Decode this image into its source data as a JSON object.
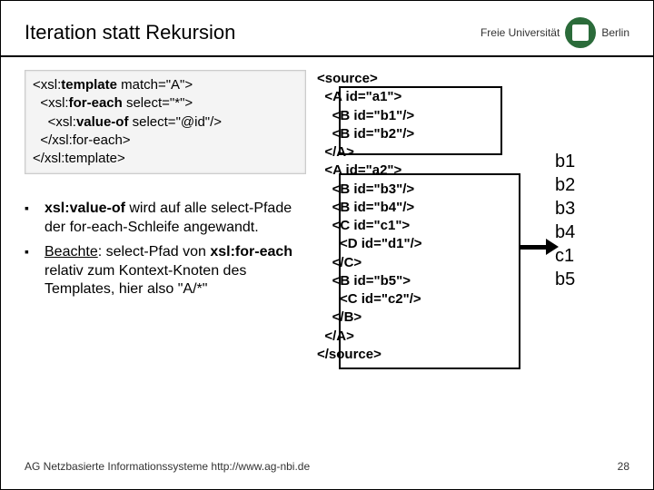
{
  "header": {
    "title": "Iteration statt Rekursion",
    "logo_text_left": "Freie Universität",
    "logo_text_right": "Berlin"
  },
  "xsl_code": {
    "l1a": "<xsl:",
    "l1b": "template",
    "l1c": " match=\"A\">",
    "l2a": "  <xsl:",
    "l2b": "for-each",
    "l2c": " select=\"*\">",
    "l3a": "    <xsl:",
    "l3b": "value-of",
    "l3c": " select=\"@id\"/>",
    "l4": "  </xsl:for-each>",
    "l5": "</xsl:template>"
  },
  "bullets": {
    "b1_pre": "xsl:value-of",
    "b1_post": " wird auf alle select-Pfade der for-each-Schleife angewandt.",
    "b2_u": "Beachte",
    "b2_mid": ": select-Pfad von ",
    "b2_bold": "xsl:for-each",
    "b2_post": " relativ zum Kontext-Knoten des Templates, hier also \"A/*\""
  },
  "xml": {
    "l1": "<source>",
    "l2": "  <A id=\"a1\">",
    "l3": "    <B id=\"b1\"/>",
    "l4": "    <B id=\"b2\"/>",
    "l5": "  </A>",
    "l6": "  <A id=\"a2\">",
    "l7": "    <B id=\"b3\"/>",
    "l8": "    <B id=\"b4\"/>",
    "l9": "    <C id=\"c1\">",
    "l10": "      <D id=\"d1\"/>",
    "l11": "    </C>",
    "l12": "    <B id=\"b5\">",
    "l13": "      <C id=\"c2\"/>",
    "l14": "    </B>",
    "l15": "  </A>",
    "l16": "</source>"
  },
  "output": {
    "lines": [
      "b1",
      "b2",
      "b3",
      "b4",
      "c1",
      "b5"
    ]
  },
  "footer": {
    "left": "AG Netzbasierte Informationssysteme http://www.ag-nbi.de",
    "page": "28"
  }
}
